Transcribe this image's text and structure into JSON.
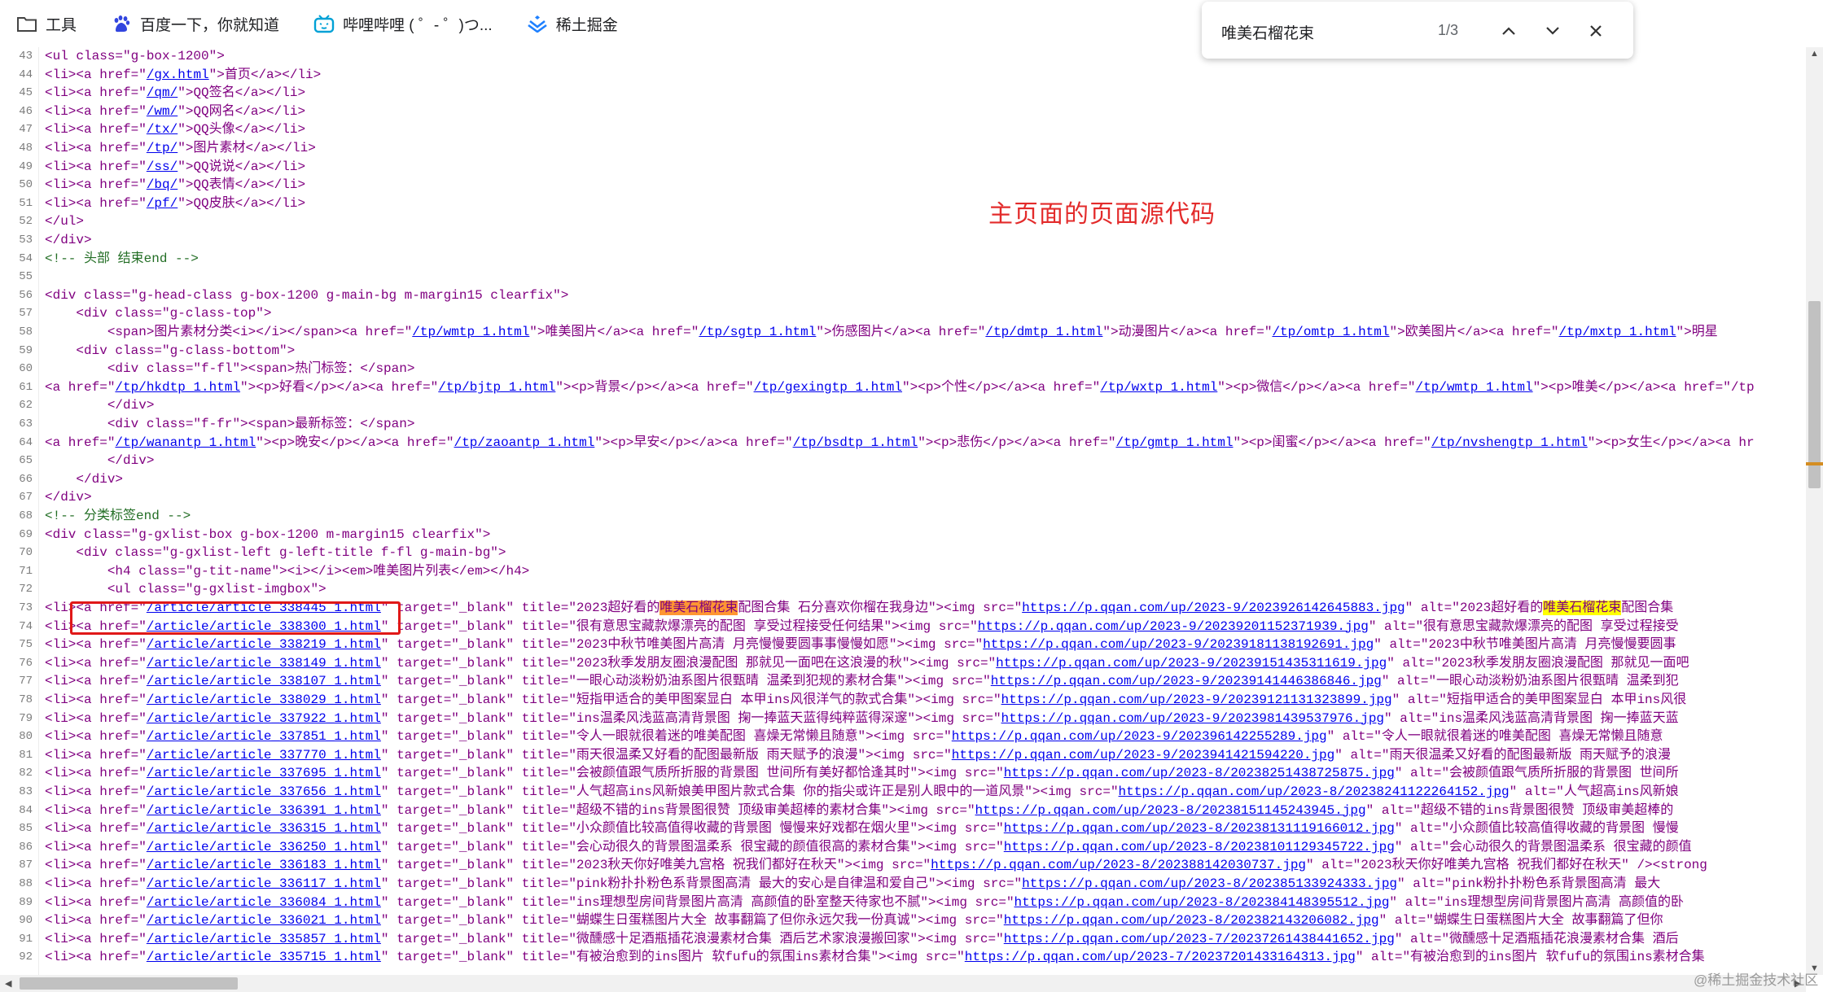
{
  "bookmarks": [
    {
      "label": "工具",
      "icon": "folder-icon"
    },
    {
      "label": "百度一下，你就知道",
      "icon": "baidu-paw-icon"
    },
    {
      "label": "哔哩哔哩 ( ゜- ゜)つ...",
      "icon": "bilibili-tv-icon"
    },
    {
      "label": "稀土掘金",
      "icon": "juejin-icon"
    }
  ],
  "find": {
    "query": "唯美石榴花束",
    "count": "1/3"
  },
  "annotation": "主页面的页面源代码",
  "watermark": "@稀土掘金技术社区",
  "lines": [
    {
      "n": "43",
      "segs": [
        [
          "t",
          "<ul class=\"g-box-1200\">"
        ]
      ]
    },
    {
      "n": "44",
      "segs": [
        [
          "t",
          "<li><a href=\""
        ],
        [
          "u",
          "/gx.html"
        ],
        [
          "t",
          "\">首页</a></li>"
        ]
      ]
    },
    {
      "n": "45",
      "segs": [
        [
          "t",
          "<li><a href=\""
        ],
        [
          "u",
          "/qm/"
        ],
        [
          "t",
          "\">QQ签名</a></li>"
        ]
      ]
    },
    {
      "n": "46",
      "segs": [
        [
          "t",
          "<li><a href=\""
        ],
        [
          "u",
          "/wm/"
        ],
        [
          "t",
          "\">QQ网名</a></li>"
        ]
      ]
    },
    {
      "n": "47",
      "segs": [
        [
          "t",
          "<li><a href=\""
        ],
        [
          "u",
          "/tx/"
        ],
        [
          "t",
          "\">QQ头像</a></li>"
        ]
      ]
    },
    {
      "n": "48",
      "segs": [
        [
          "t",
          "<li><a href=\""
        ],
        [
          "u",
          "/tp/"
        ],
        [
          "t",
          "\">图片素材</a></li>"
        ]
      ]
    },
    {
      "n": "49",
      "segs": [
        [
          "t",
          "<li><a href=\""
        ],
        [
          "u",
          "/ss/"
        ],
        [
          "t",
          "\">QQ说说</a></li>"
        ]
      ]
    },
    {
      "n": "50",
      "segs": [
        [
          "t",
          "<li><a href=\""
        ],
        [
          "u",
          "/bq/"
        ],
        [
          "t",
          "\">QQ表情</a></li>"
        ]
      ]
    },
    {
      "n": "51",
      "segs": [
        [
          "t",
          "<li><a href=\""
        ],
        [
          "u",
          "/pf/"
        ],
        [
          "t",
          "\">QQ皮肤</a></li>"
        ]
      ]
    },
    {
      "n": "52",
      "segs": [
        [
          "t",
          "</ul>"
        ]
      ]
    },
    {
      "n": "53",
      "segs": [
        [
          "t",
          "</div>"
        ]
      ]
    },
    {
      "n": "54",
      "segs": [
        [
          "c",
          "<!-- 头部 结束end -->"
        ]
      ]
    },
    {
      "n": "55",
      "segs": []
    },
    {
      "n": "56",
      "segs": [
        [
          "t",
          "<div class=\"g-head-class g-box-1200 g-main-bg m-margin15 clearfix\">"
        ]
      ]
    },
    {
      "n": "57",
      "segs": [
        [
          "t",
          "    <div class=\"g-class-top\">"
        ]
      ]
    },
    {
      "n": "58",
      "segs": [
        [
          "t",
          "        <span>图片素材分类<i></i></span><a href=\""
        ],
        [
          "u",
          "/tp/wmtp_1.html"
        ],
        [
          "t",
          "\">唯美图片</a><a href=\""
        ],
        [
          "u",
          "/tp/sgtp_1.html"
        ],
        [
          "t",
          "\">伤感图片</a><a href=\""
        ],
        [
          "u",
          "/tp/dmtp_1.html"
        ],
        [
          "t",
          "\">动漫图片</a><a href=\""
        ],
        [
          "u",
          "/tp/omtp_1.html"
        ],
        [
          "t",
          "\">欧美图片</a><a href=\""
        ],
        [
          "u",
          "/tp/mxtp_1.html"
        ],
        [
          "t",
          "\">明星"
        ]
      ]
    },
    {
      "n": "59",
      "segs": [
        [
          "t",
          "    <div class=\"g-class-bottom\">"
        ]
      ]
    },
    {
      "n": "60",
      "segs": [
        [
          "t",
          "        <div class=\"f-fl\"><span>热门标签：</span>"
        ]
      ]
    },
    {
      "n": "61",
      "segs": [
        [
          "t",
          "<a href=\""
        ],
        [
          "u",
          "/tp/hkdtp_1.html"
        ],
        [
          "t",
          "\"><p>好看</p></a><a href=\""
        ],
        [
          "u",
          "/tp/bjtp_1.html"
        ],
        [
          "t",
          "\"><p>背景</p></a><a href=\""
        ],
        [
          "u",
          "/tp/gexingtp_1.html"
        ],
        [
          "t",
          "\"><p>个性</p></a><a href=\""
        ],
        [
          "u",
          "/tp/wxtp_1.html"
        ],
        [
          "t",
          "\"><p>微信</p></a><a href=\""
        ],
        [
          "u",
          "/tp/wmtp_1.html"
        ],
        [
          "t",
          "\"><p>唯美</p></a><a href=\"/tp"
        ]
      ]
    },
    {
      "n": "62",
      "segs": [
        [
          "t",
          "        </div>"
        ]
      ]
    },
    {
      "n": "63",
      "segs": [
        [
          "t",
          "        <div class=\"f-fr\"><span>最新标签：</span>"
        ]
      ]
    },
    {
      "n": "64",
      "segs": [
        [
          "t",
          "<a href=\""
        ],
        [
          "u",
          "/tp/wanantp_1.html"
        ],
        [
          "t",
          "\"><p>晚安</p></a><a href=\""
        ],
        [
          "u",
          "/tp/zaoantp_1.html"
        ],
        [
          "t",
          "\"><p>早安</p></a><a href=\""
        ],
        [
          "u",
          "/tp/bsdtp_1.html"
        ],
        [
          "t",
          "\"><p>悲伤</p></a><a href=\""
        ],
        [
          "u",
          "/tp/gmtp_1.html"
        ],
        [
          "t",
          "\"><p>闺蜜</p></a><a href=\""
        ],
        [
          "u",
          "/tp/nvshengtp_1.html"
        ],
        [
          "t",
          "\"><p>女生</p></a><a hr"
        ]
      ]
    },
    {
      "n": "65",
      "segs": [
        [
          "t",
          "        </div>"
        ]
      ]
    },
    {
      "n": "66",
      "segs": [
        [
          "t",
          "    </div>"
        ]
      ]
    },
    {
      "n": "67",
      "segs": [
        [
          "t",
          "</div>"
        ]
      ]
    },
    {
      "n": "68",
      "segs": [
        [
          "c",
          "<!-- 分类标签end -->"
        ]
      ]
    },
    {
      "n": "69",
      "segs": [
        [
          "t",
          "<div class=\"g-gxlist-box g-box-1200 m-margin15 clearfix\">"
        ]
      ]
    },
    {
      "n": "70",
      "segs": [
        [
          "t",
          "    <div class=\"g-gxlist-left g-left-title f-fl g-main-bg\">"
        ]
      ]
    },
    {
      "n": "71",
      "segs": [
        [
          "t",
          "        <h4 class=\"g-tit-name\"><i></i><em>唯美图片列表</em></h4>"
        ]
      ]
    },
    {
      "n": "72",
      "segs": [
        [
          "t",
          "        <ul class=\"g-gxlist-imgbox\">"
        ]
      ]
    },
    {
      "n": "73",
      "segs": [
        [
          "t",
          "<li><a href=\""
        ],
        [
          "u",
          "/article/article_338445_1.html"
        ],
        [
          "t",
          "\" target=\"_blank\" title=\"2023超好看的"
        ],
        [
          "h",
          "唯美石榴花束"
        ],
        [
          "t",
          "配图合集 石分喜欢你榴在我身边\"><img src=\""
        ],
        [
          "u",
          "https://p.qqan.com/up/2023-9/2023926142645883.jpg"
        ],
        [
          "t",
          "\" alt=\"2023超好看的"
        ],
        [
          "h2",
          "唯美石榴花束"
        ],
        [
          "t",
          "配图合集"
        ]
      ]
    },
    {
      "n": "74",
      "segs": [
        [
          "t",
          "<li><a href=\""
        ],
        [
          "u",
          "/article/article_338300_1.html"
        ],
        [
          "t",
          "\" target=\"_blank\" title=\"很有意思宝藏款爆漂亮的配图 享受过程接受任何结果\"><img src=\""
        ],
        [
          "u",
          "https://p.qqan.com/up/2023-9/20239201152371939.jpg"
        ],
        [
          "t",
          "\" alt=\"很有意思宝藏款爆漂亮的配图 享受过程接受"
        ]
      ]
    },
    {
      "n": "75",
      "segs": [
        [
          "t",
          "<li><a href=\""
        ],
        [
          "u",
          "/article/article_338219_1.html"
        ],
        [
          "t",
          "\" target=\"_blank\" title=\"2023中秋节唯美图片高清 月亮慢慢要圆事事慢慢如愿\"><img src=\""
        ],
        [
          "u",
          "https://p.qqan.com/up/2023-9/20239181138192691.jpg"
        ],
        [
          "t",
          "\" alt=\"2023中秋节唯美图片高清 月亮慢慢要圆事"
        ]
      ]
    },
    {
      "n": "76",
      "segs": [
        [
          "t",
          "<li><a href=\""
        ],
        [
          "u",
          "/article/article_338149_1.html"
        ],
        [
          "t",
          "\" target=\"_blank\" title=\"2023秋季发朋友圈浪漫配图 那就见一面吧在这浪漫的秋\"><img src=\""
        ],
        [
          "u",
          "https://p.qqan.com/up/2023-9/20239151435311619.jpg"
        ],
        [
          "t",
          "\" alt=\"2023秋季发朋友圈浪漫配图 那就见一面吧"
        ]
      ]
    },
    {
      "n": "77",
      "segs": [
        [
          "t",
          "<li><a href=\""
        ],
        [
          "u",
          "/article/article_338107_1.html"
        ],
        [
          "t",
          "\" target=\"_blank\" title=\"一眼心动淡粉奶油系图片很甄晴 温柔到犯规的素材合集\"><img src=\""
        ],
        [
          "u",
          "https://p.qqan.com/up/2023-9/20239141446386846.jpg"
        ],
        [
          "t",
          "\" alt=\"一眼心动淡粉奶油系图片很甄晴 温柔到犯"
        ]
      ]
    },
    {
      "n": "78",
      "segs": [
        [
          "t",
          "<li><a href=\""
        ],
        [
          "u",
          "/article/article_338029_1.html"
        ],
        [
          "t",
          "\" target=\"_blank\" title=\"短指甲适合的美甲图案显白 本甲ins风很洋气的款式合集\"><img src=\""
        ],
        [
          "u",
          "https://p.qqan.com/up/2023-9/20239121131323899.jpg"
        ],
        [
          "t",
          "\" alt=\"短指甲适合的美甲图案显白 本甲ins风很"
        ]
      ]
    },
    {
      "n": "79",
      "segs": [
        [
          "t",
          "<li><a href=\""
        ],
        [
          "u",
          "/article/article_337922_1.html"
        ],
        [
          "t",
          "\" target=\"_blank\" title=\"ins温柔风浅蓝高清背景图 掬一捧蓝天蓝得纯粹蓝得深邃\"><img src=\""
        ],
        [
          "u",
          "https://p.qqan.com/up/2023-9/2023981439537976.jpg"
        ],
        [
          "t",
          "\" alt=\"ins温柔风浅蓝高清背景图 掬一捧蓝天蓝"
        ]
      ]
    },
    {
      "n": "80",
      "segs": [
        [
          "t",
          "<li><a href=\""
        ],
        [
          "u",
          "/article/article_337851_1.html"
        ],
        [
          "t",
          "\" target=\"_blank\" title=\"令人一眼就很着迷的唯美配图 喜燥无常懒且随意\"><img src=\""
        ],
        [
          "u",
          "https://p.qqan.com/up/2023-9/2023961422552​89.jpg"
        ],
        [
          "t",
          "\" alt=\"令人一眼就很着迷的唯美配图 喜燥无常懒且随意"
        ]
      ]
    },
    {
      "n": "81",
      "segs": [
        [
          "t",
          "<li><a href=\""
        ],
        [
          "u",
          "/article/article_337770_1.html"
        ],
        [
          "t",
          "\" target=\"_blank\" title=\"雨天很温柔又好看的配图最新版 雨天赋予的浪漫\"><img src=\""
        ],
        [
          "u",
          "https://p.qqan.com/up/2023-9/2023941421594220.jpg"
        ],
        [
          "t",
          "\" alt=\"雨天很温柔又好看的配图最新版 雨天赋予的浪漫"
        ]
      ]
    },
    {
      "n": "82",
      "segs": [
        [
          "t",
          "<li><a href=\""
        ],
        [
          "u",
          "/article/article_337695_1.html"
        ],
        [
          "t",
          "\" target=\"_blank\" title=\"会被颜值跟气质所折服的背景图 世间所有美好都恰逢其时\"><img src=\""
        ],
        [
          "u",
          "https://p.qqan.com/up/2023-8/20238251438725875.jpg"
        ],
        [
          "t",
          "\" alt=\"会被颜值跟气质所折服的背景图 世间所"
        ]
      ]
    },
    {
      "n": "83",
      "segs": [
        [
          "t",
          "<li><a href=\""
        ],
        [
          "u",
          "/article/article_337656_1.html"
        ],
        [
          "t",
          "\" target=\"_blank\" title=\"人气超高ins风新娘美甲图片款式合集 你的指尖或许正是别人眼中的一道风景\"><img src=\""
        ],
        [
          "u",
          "https://p.qqan.com/up/2023-8/20238241122264152.jpg"
        ],
        [
          "t",
          "\" alt=\"人气超高ins风新娘"
        ]
      ]
    },
    {
      "n": "84",
      "segs": [
        [
          "t",
          "<li><a href=\""
        ],
        [
          "u",
          "/article/article_336391_1.html"
        ],
        [
          "t",
          "\" target=\"_blank\" title=\"超级不错的ins背景图很赞 顶级审美超棒的素材合集\"><img src=\""
        ],
        [
          "u",
          "https://p.qqan.com/up/2023-8/20238151145243945.jpg"
        ],
        [
          "t",
          "\" alt=\"超级不错的ins背景图很赞 顶级审美超棒的"
        ]
      ]
    },
    {
      "n": "85",
      "segs": [
        [
          "t",
          "<li><a href=\""
        ],
        [
          "u",
          "/article/article_336315_1.html"
        ],
        [
          "t",
          "\" target=\"_blank\" title=\"小众颜值比较高值得收藏的背景图 慢慢来好戏都在烟火里\"><img src=\""
        ],
        [
          "u",
          "https://p.qqan.com/up/2023-8/20238131119166012.jpg"
        ],
        [
          "t",
          "\" alt=\"小众颜值比较高值得收藏的背景图 慢慢"
        ]
      ]
    },
    {
      "n": "86",
      "segs": [
        [
          "t",
          "<li><a href=\""
        ],
        [
          "u",
          "/article/article_336250_1.html"
        ],
        [
          "t",
          "\" target=\"_blank\" title=\"会心动很久的背景图温柔系 很宝藏的颜值很高的素材合集\"><img src=\""
        ],
        [
          "u",
          "https://p.qqan.com/up/2023-8/20238101129345722.jpg"
        ],
        [
          "t",
          "\" alt=\"会心动很久的背景图温柔系 很宝藏的颜值"
        ]
      ]
    },
    {
      "n": "87",
      "segs": [
        [
          "t",
          "<li><a href=\""
        ],
        [
          "u",
          "/article/article_336183_1.html"
        ],
        [
          "t",
          "\" target=\"_blank\" title=\"2023秋天你好唯美九宫格 祝我们都好在秋天\"><img src=\""
        ],
        [
          "u",
          "https://p.qqan.com/up/2023-8/20238814203073​7.jpg"
        ],
        [
          "t",
          "\" alt=\"2023秋天你好唯美九宫格 祝我们都好在秋天\" /><strong"
        ]
      ]
    },
    {
      "n": "88",
      "segs": [
        [
          "t",
          "<li><a href=\""
        ],
        [
          "u",
          "/article/article_336117_1.html"
        ],
        [
          "t",
          "\" target=\"_blank\" title=\"pink粉扑扑粉色系背景图高清 最大的安心是自律温和爱自己\"><img src=\""
        ],
        [
          "u",
          "https://p.qqan.com/up/2023-8/202385133924333.jpg"
        ],
        [
          "t",
          "\" alt=\"pink粉扑扑粉色系背景图高清 最大"
        ]
      ]
    },
    {
      "n": "89",
      "segs": [
        [
          "t",
          "<li><a href=\""
        ],
        [
          "u",
          "/article/article_336084_1.html"
        ],
        [
          "t",
          "\" target=\"_blank\" title=\"ins理想型房间背景图片高清 高颜值的卧室整天待家也不腻\"><img src=\""
        ],
        [
          "u",
          "https://p.qqan.com/up/2023-8/20238414839551​2.jpg"
        ],
        [
          "t",
          "\" alt=\"ins理想型房间背景图片高清 高颜值的卧"
        ]
      ]
    },
    {
      "n": "90",
      "segs": [
        [
          "t",
          "<li><a href=\""
        ],
        [
          "u",
          "/article/article_336021_1.html"
        ],
        [
          "t",
          "\" target=\"_blank\" title=\"蝴蝶生日蛋糕图片大全 故事翻篇了但你永远欠我一份真诚\"><img src=\""
        ],
        [
          "u",
          "https://p.qqan.com/up/2023-8/2023821432060​82.jpg"
        ],
        [
          "t",
          "\" alt=\"蝴蝶生日蛋糕图片大全 故事翻篇了但你"
        ]
      ]
    },
    {
      "n": "91",
      "segs": [
        [
          "t",
          "<li><a href=\""
        ],
        [
          "u",
          "/article/article_335857_1.html"
        ],
        [
          "t",
          "\" target=\"_blank\" title=\"微醺感十足酒瓶插花浪漫素材合集 酒后艺术家浪漫搬回家\"><img src=\""
        ],
        [
          "u",
          "https://p.qqan.com/up/2023-7/20237261438441652.jpg"
        ],
        [
          "t",
          "\" alt=\"微醺感十足酒瓶插花浪漫素材合集 酒后"
        ]
      ]
    },
    {
      "n": "92",
      "segs": [
        [
          "t",
          "<li><a href=\""
        ],
        [
          "u",
          "/article/article_335715_1.html"
        ],
        [
          "t",
          "\" target=\"_blank\" title=\"有被治愈到的ins图片 软fufu的氛围ins素材合集\"><img src=\""
        ],
        [
          "u",
          "https://p.qqan.com/up/2023-7/20237201433164313.jpg"
        ],
        [
          "t",
          "\" alt=\"有被治愈到的ins图片 软fufu的氛围ins素材合集"
        ]
      ]
    }
  ]
}
